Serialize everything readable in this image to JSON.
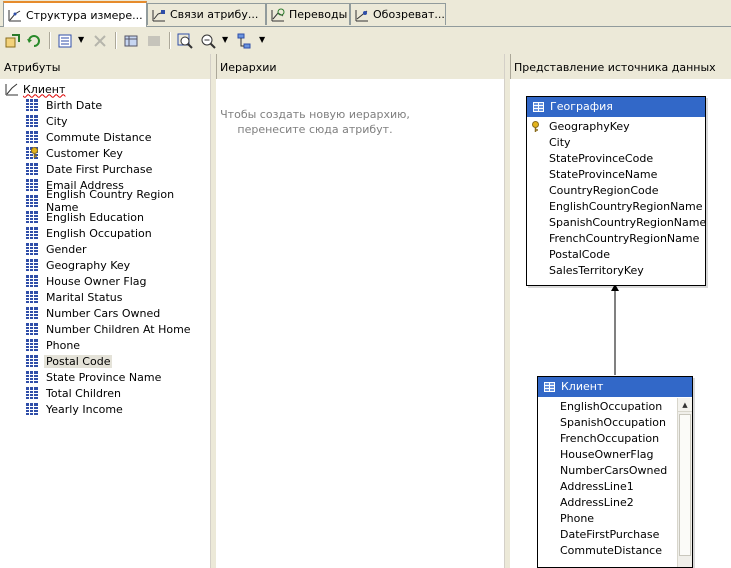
{
  "tabs": [
    {
      "label": "Структура измере...",
      "icon": "dimension-structure-icon",
      "active": true
    },
    {
      "label": "Связи атрибу...",
      "icon": "attribute-relationships-icon",
      "active": false
    },
    {
      "label": "Переводы",
      "icon": "translations-icon",
      "active": false
    },
    {
      "label": "Обозреват...",
      "icon": "browser-icon",
      "active": false
    }
  ],
  "toolbar": {
    "icons": [
      "process-icon",
      "refresh-icon",
      "view-options-icon",
      "delete-icon",
      "show-table-icon",
      "hide-table-icon",
      "zoom-fit-icon",
      "zoom-icon",
      "arrange-icon"
    ]
  },
  "panes": {
    "attributes": {
      "title": "Атрибуты",
      "root_label": "Клиент",
      "items": [
        {
          "label": "Birth Date",
          "key": false
        },
        {
          "label": "City",
          "key": false
        },
        {
          "label": "Commute Distance",
          "key": false
        },
        {
          "label": "Customer Key",
          "key": true
        },
        {
          "label": "Date First Purchase",
          "key": false
        },
        {
          "label": "Email Address",
          "key": false
        },
        {
          "label": "English Country Region Name",
          "key": false
        },
        {
          "label": "English Education",
          "key": false
        },
        {
          "label": "English Occupation",
          "key": false
        },
        {
          "label": "Gender",
          "key": false
        },
        {
          "label": "Geography Key",
          "key": false
        },
        {
          "label": "House Owner Flag",
          "key": false
        },
        {
          "label": "Marital Status",
          "key": false
        },
        {
          "label": "Number Cars Owned",
          "key": false
        },
        {
          "label": "Number Children At Home",
          "key": false
        },
        {
          "label": "Phone",
          "key": false
        },
        {
          "label": "Postal Code",
          "key": false,
          "selected": true
        },
        {
          "label": "State Province Name",
          "key": false
        },
        {
          "label": "Total Children",
          "key": false
        },
        {
          "label": "Yearly Income",
          "key": false
        }
      ]
    },
    "hierarchies": {
      "title": "Иерархии",
      "hint": "Чтобы создать новую иерархию, перенесите сюда атрибут."
    },
    "dsv": {
      "title": "Представление источника данных",
      "tables": [
        {
          "name": "География",
          "columns": [
            "GeographyKey",
            "City",
            "StateProvinceCode",
            "StateProvinceName",
            "CountryRegionCode",
            "EnglishCountryRegionName",
            "SpanishCountryRegionName",
            "FrenchCountryRegionName",
            "PostalCode",
            "SalesTerritoryKey"
          ],
          "key_column": "GeographyKey"
        },
        {
          "name": "Клиент",
          "columns": [
            "EnglishOccupation",
            "SpanishOccupation",
            "FrenchOccupation",
            "HouseOwnerFlag",
            "NumberCarsOwned",
            "AddressLine1",
            "AddressLine2",
            "Phone",
            "DateFirstPurchase",
            "CommuteDistance"
          ]
        }
      ]
    }
  },
  "colors": {
    "table_header": "#3268c8",
    "active_tab_accent": "#e68b2c",
    "chrome": "#ece9d8"
  }
}
